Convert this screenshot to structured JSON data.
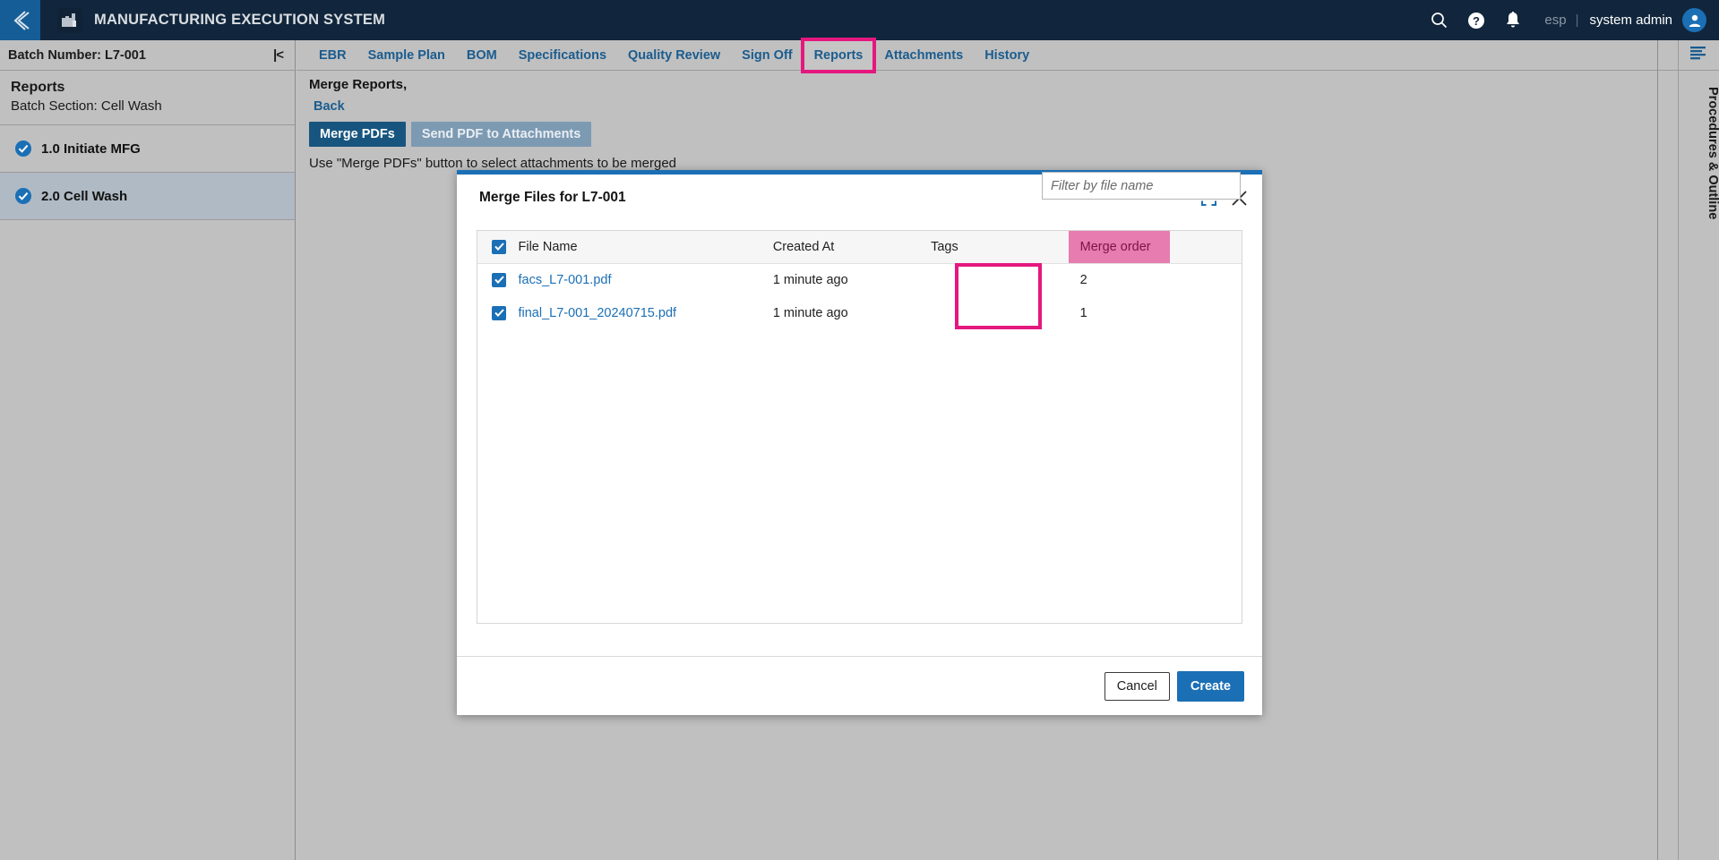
{
  "header": {
    "back_icon": "chevron-left-icon",
    "logo_icon": "factory-icon",
    "title": "MANUFACTURING EXECUTION SYSTEM",
    "search_icon": "search-icon",
    "help_icon": "help-circle-icon",
    "notifications_icon": "bell-icon",
    "locale": "esp",
    "separator": "|",
    "user_name": "system admin",
    "avatar_icon": "user-avatar-icon"
  },
  "sidebar": {
    "batch_label": "Batch Number: L7-001",
    "collapse_icon": "collapse-left-icon",
    "section_title": "Reports",
    "section_subtitle": "Batch Section: Cell Wash",
    "steps": [
      {
        "label": "1.0 Initiate MFG",
        "status_icon": "check-circle-icon",
        "active": false
      },
      {
        "label": "2.0 Cell Wash",
        "status_icon": "check-circle-icon",
        "active": true
      }
    ]
  },
  "tabs": [
    {
      "label": "EBR",
      "highlighted": false
    },
    {
      "label": "Sample Plan",
      "highlighted": false
    },
    {
      "label": "BOM",
      "highlighted": false
    },
    {
      "label": "Specifications",
      "highlighted": false
    },
    {
      "label": "Quality Review",
      "highlighted": false
    },
    {
      "label": "Sign Off",
      "highlighted": false
    },
    {
      "label": "Reports",
      "highlighted": true
    },
    {
      "label": "Attachments",
      "highlighted": false
    },
    {
      "label": "History",
      "highlighted": false
    }
  ],
  "content": {
    "heading": "Merge Reports,",
    "back_link": "Back",
    "merge_pdfs_label": "Merge PDFs",
    "send_pdf_label": "Send PDF to Attachments",
    "hint": "Use \"Merge PDFs\" button to select attachments to be merged"
  },
  "right_rail": {
    "list_icon": "list-lines-icon",
    "label": "Procedures & Outline"
  },
  "modal": {
    "title": "Merge Files for L7-001",
    "expand_icon": "expand-icon",
    "close_icon": "close-icon",
    "filter_placeholder": "Filter by file name",
    "filter_value": "",
    "columns": [
      "",
      "File Name",
      "Created At",
      "Tags",
      "Merge order",
      ""
    ],
    "rows": [
      {
        "selected": true,
        "file_name": "facs_L7-001.pdf",
        "created_at": "1 minute ago",
        "tags": "",
        "merge_order": "2"
      },
      {
        "selected": true,
        "file_name": "final_L7-001_20240715.pdf",
        "created_at": "1 minute ago",
        "tags": "",
        "merge_order": "1"
      }
    ],
    "select_all": true,
    "cancel_label": "Cancel",
    "create_label": "Create"
  },
  "colors": {
    "header_bg": "#11263c",
    "accent_blue": "#1b6fb5",
    "link_blue": "#1b5c8e",
    "highlight_magenta": "#e5177f",
    "header_pink": "#e67cb0",
    "page_bg": "#c0c0c0"
  }
}
